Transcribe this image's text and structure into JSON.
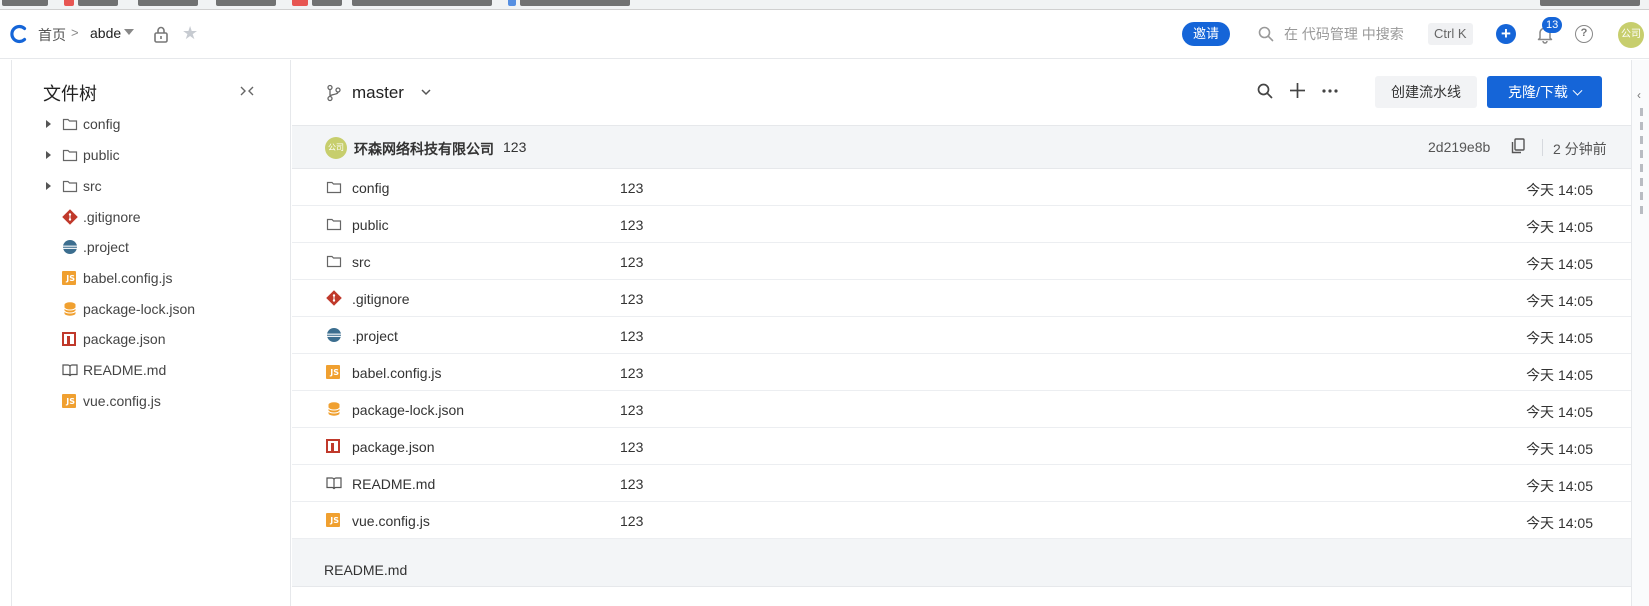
{
  "header": {
    "breadcrumb_home": "首页",
    "breadcrumb_sep": ">",
    "repo_name": "abde",
    "invite_label": "邀请",
    "search_placeholder": "在 代码管理 中搜索",
    "shortcut": "Ctrl K",
    "notification_count": "13",
    "help_label": "?",
    "avatar_label": "公司"
  },
  "sidebar": {
    "title": "文件树",
    "items": [
      {
        "label": "config",
        "type": "folder"
      },
      {
        "label": "public",
        "type": "folder"
      },
      {
        "label": "src",
        "type": "folder"
      },
      {
        "label": ".gitignore",
        "type": "git"
      },
      {
        "label": ".project",
        "type": "eclipse"
      },
      {
        "label": "babel.config.js",
        "type": "js"
      },
      {
        "label": "package-lock.json",
        "type": "db"
      },
      {
        "label": "package.json",
        "type": "npm"
      },
      {
        "label": "README.md",
        "type": "book"
      },
      {
        "label": "vue.config.js",
        "type": "js"
      }
    ]
  },
  "toolbar": {
    "branch": "master",
    "pipeline_label": "创建流水线",
    "clone_label": "克隆/下载"
  },
  "commit": {
    "avatar_label": "公司",
    "author": "环森网络科技有限公司",
    "message": "123",
    "hash": "2d219e8b",
    "time": "2 分钟前"
  },
  "files": [
    {
      "name": "config",
      "type": "folder",
      "message": "123",
      "time": "今天 14:05"
    },
    {
      "name": "public",
      "type": "folder",
      "message": "123",
      "time": "今天 14:05"
    },
    {
      "name": "src",
      "type": "folder",
      "message": "123",
      "time": "今天 14:05"
    },
    {
      "name": ".gitignore",
      "type": "git",
      "message": "123",
      "time": "今天 14:05"
    },
    {
      "name": ".project",
      "type": "eclipse",
      "message": "123",
      "time": "今天 14:05"
    },
    {
      "name": "babel.config.js",
      "type": "js",
      "message": "123",
      "time": "今天 14:05"
    },
    {
      "name": "package-lock.json",
      "type": "db",
      "message": "123",
      "time": "今天 14:05"
    },
    {
      "name": "package.json",
      "type": "npm",
      "message": "123",
      "time": "今天 14:05"
    },
    {
      "name": "README.md",
      "type": "book",
      "message": "123",
      "time": "今天 14:05"
    },
    {
      "name": "vue.config.js",
      "type": "js",
      "message": "123",
      "time": "今天 14:05"
    }
  ],
  "readme": {
    "title": "README.md"
  },
  "icons": {
    "logo": "brand-c-logo-icon",
    "lock": "lock-icon",
    "star": "star-icon",
    "search": "search-icon",
    "bell": "bell-icon",
    "help": "help-icon",
    "collapse": "collapse-tree-icon",
    "branch": "git-branch-icon",
    "copy": "copy-icon",
    "more": "more-icon"
  },
  "colors": {
    "primary": "#1565d8",
    "avatar": "#c7ce6d",
    "js": "#f0a030",
    "git": "#c0392b",
    "db": "#f0a030",
    "eclipse": "#3c6e8f"
  }
}
